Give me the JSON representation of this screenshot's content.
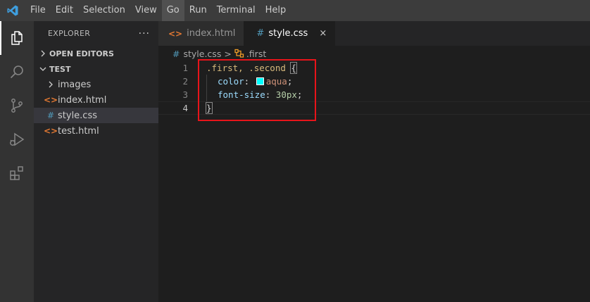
{
  "menu": [
    "File",
    "Edit",
    "Selection",
    "View",
    "Go",
    "Run",
    "Terminal",
    "Help"
  ],
  "menu_active_index": 4,
  "activity_icons": [
    "explorer-icon",
    "search-icon",
    "source-control-icon",
    "run-debug-icon",
    "extensions-icon"
  ],
  "sidebar": {
    "title": "EXPLORER",
    "more": "···",
    "open_editors": "OPEN EDITORS",
    "folder": "TEST",
    "items": [
      {
        "icon": "›",
        "label": "images",
        "type": "folder"
      },
      {
        "icon": "<>",
        "label": "index.html",
        "type": "html"
      },
      {
        "icon": "#",
        "label": "style.css",
        "type": "css",
        "selected": true
      },
      {
        "icon": "<>",
        "label": "test.html",
        "type": "html"
      }
    ]
  },
  "tabs": [
    {
      "label": "index.html",
      "icon": "<>",
      "active": false
    },
    {
      "label": "style.css",
      "icon": "#",
      "active": true,
      "close": "×"
    }
  ],
  "breadcrumb": {
    "file": "style.css",
    "separator": ">",
    "symbol": ".first"
  },
  "code": {
    "line_numbers": [
      "1",
      "2",
      "3",
      "4"
    ],
    "line1": {
      "selector": ".first, .second",
      "open_brace": "{"
    },
    "line2": {
      "prop": "color",
      "colon": ":",
      "value": "aqua",
      "semicolon": ";",
      "swatch_color": "#00ffff"
    },
    "line3": {
      "prop": "font-size",
      "colon": ":",
      "value": "30px",
      "semicolon": ";"
    },
    "line4": {
      "close_brace": "}"
    }
  },
  "colors": {
    "html_icon": "#e37933",
    "css_icon": "#519aba",
    "highlight": "#e8141a",
    "accent": "#007acc"
  }
}
